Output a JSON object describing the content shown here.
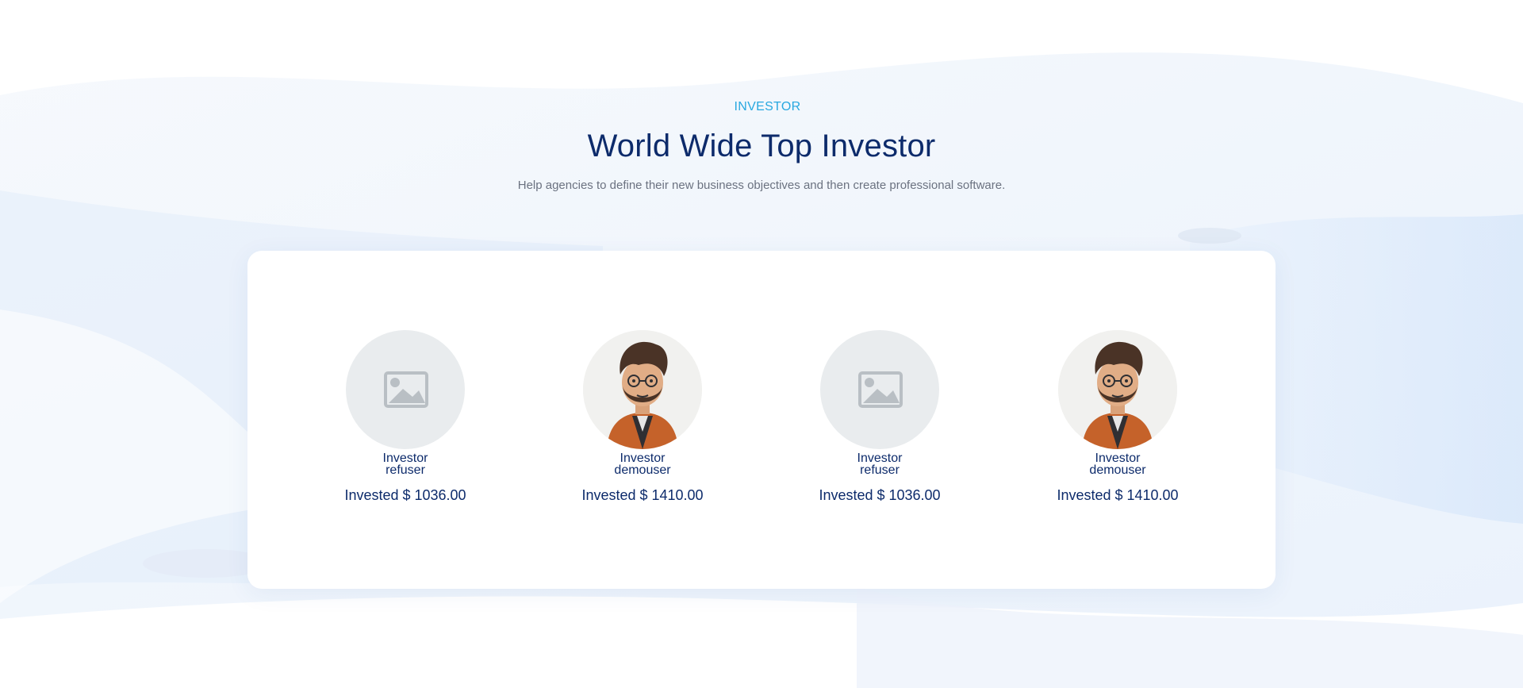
{
  "section": {
    "eyebrow": "INVESTOR",
    "title": "World Wide Top Investor",
    "subtitle": "Help agencies to define their new business objectives and then create professional software."
  },
  "colors": {
    "accent": "#28a8e0",
    "heading": "#0d2b6b",
    "muted": "#6b7280",
    "placeholder_bg": "#e9ecee",
    "placeholder_icon": "#b9bfc4"
  },
  "investors": [
    {
      "line1": "Investor",
      "line2": "refuser",
      "amount": "Invested $ 1036.00",
      "avatar": "image-placeholder-icon"
    },
    {
      "line1": "Investor",
      "line2": "demouser",
      "amount": "Invested $ 1410.00",
      "avatar": "cartoon-man-avatar"
    },
    {
      "line1": "Investor",
      "line2": "refuser",
      "amount": "Invested $ 1036.00",
      "avatar": "image-placeholder-icon"
    },
    {
      "line1": "Investor",
      "line2": "demouser",
      "amount": "Invested $ 1410.00",
      "avatar": "cartoon-man-avatar"
    }
  ]
}
